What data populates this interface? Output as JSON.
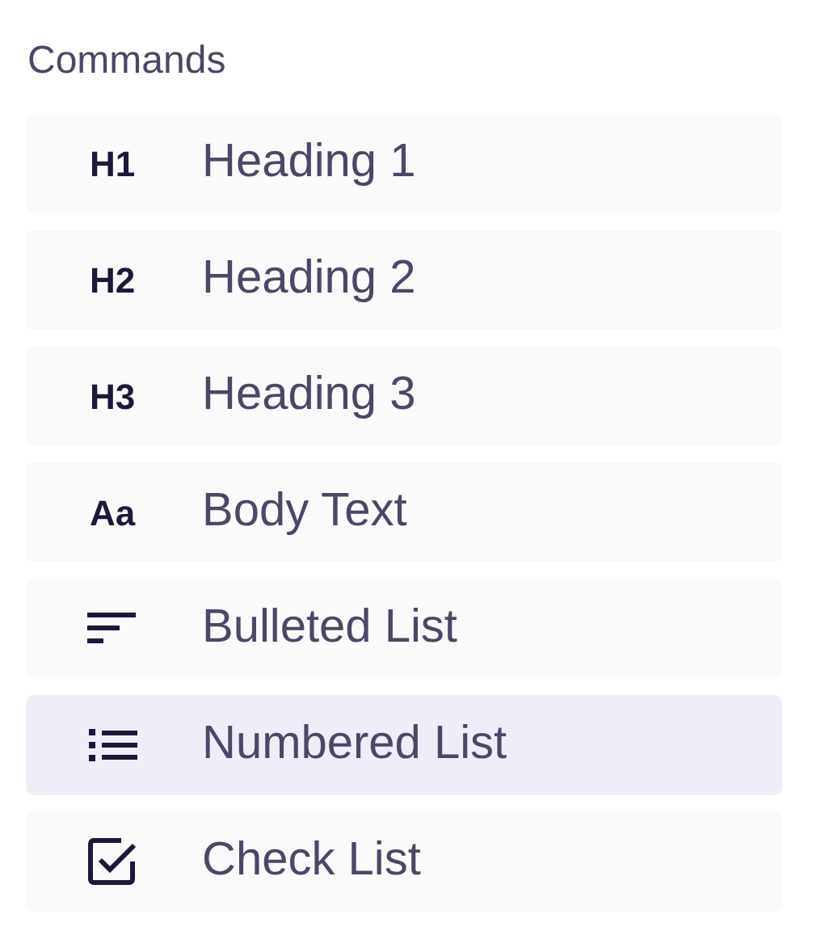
{
  "title": "Commands",
  "commands": [
    {
      "kind": "text-icon",
      "icon_text": "H1",
      "label": "Heading 1",
      "selected": false
    },
    {
      "kind": "text-icon",
      "icon_text": "H2",
      "label": "Heading 2",
      "selected": false
    },
    {
      "kind": "text-icon",
      "icon_text": "H3",
      "label": "Heading 3",
      "selected": false
    },
    {
      "kind": "text-icon",
      "icon_text": "Aa",
      "label": "Body Text",
      "selected": false
    },
    {
      "kind": "bulleted",
      "label": "Bulleted List",
      "selected": false
    },
    {
      "kind": "numbered",
      "label": "Numbered List",
      "selected": true
    },
    {
      "kind": "check",
      "label": "Check List",
      "selected": false
    }
  ]
}
